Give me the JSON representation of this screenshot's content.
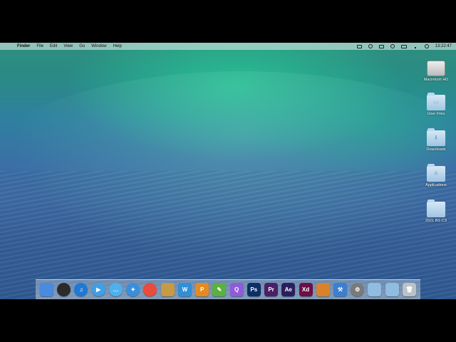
{
  "menubar": {
    "app": "Finder",
    "items": [
      "File",
      "Edit",
      "View",
      "Go",
      "Window",
      "Help"
    ],
    "time": "13:22:47"
  },
  "desktop": [
    {
      "label": "Macintosh HD",
      "kind": "drive"
    },
    {
      "label": "User Files",
      "kind": "folder"
    },
    {
      "label": "Downloads",
      "kind": "folder"
    },
    {
      "label": "Applications",
      "kind": "folder"
    },
    {
      "label": "2021 BS CS",
      "kind": "folder"
    }
  ],
  "dock": [
    {
      "name": "finder",
      "text": "",
      "bg": "#4a8be0"
    },
    {
      "name": "dashboard",
      "text": "",
      "bg": "#2b2b2b"
    },
    {
      "name": "itunes",
      "text": "♫",
      "bg": "#1e78d6"
    },
    {
      "name": "facetime",
      "text": "▶",
      "bg": "#3ea0e6"
    },
    {
      "name": "messages",
      "text": "…",
      "bg": "#4fb0ee"
    },
    {
      "name": "safari",
      "text": "✦",
      "bg": "#3a8fdc"
    },
    {
      "name": "chrome",
      "text": "",
      "bg": "#e94b3c"
    },
    {
      "name": "preview",
      "text": "",
      "bg": "#c79a45"
    },
    {
      "name": "wunderlist",
      "text": "W",
      "bg": "#2f8fd8"
    },
    {
      "name": "pencil",
      "text": "P",
      "bg": "#e48a23"
    },
    {
      "name": "evernote",
      "text": "✎",
      "bg": "#5bb040"
    },
    {
      "name": "purple-app",
      "text": "Q",
      "bg": "#8f5bd8"
    },
    {
      "name": "photoshop",
      "text": "Ps",
      "bg": "#0c2f66"
    },
    {
      "name": "premiere",
      "text": "Pr",
      "bg": "#4b1f66"
    },
    {
      "name": "after-effects",
      "text": "Ae",
      "bg": "#2a1f5e"
    },
    {
      "name": "adobe-xd",
      "text": "Xd",
      "bg": "#6a1046"
    },
    {
      "name": "image-capture",
      "text": "",
      "bg": "#d9822b"
    },
    {
      "name": "xcode",
      "text": "⚒",
      "bg": "#3c7fd1"
    },
    {
      "name": "system-preferences",
      "text": "⚙",
      "bg": "#7a7a7a"
    },
    {
      "name": "folder-a",
      "text": "",
      "bg": "#8fbce0"
    },
    {
      "name": "folder-b",
      "text": "",
      "bg": "#8fbce0"
    },
    {
      "name": "trash",
      "text": "🗑",
      "bg": "#b9c2c8"
    }
  ],
  "colors": {
    "menubar_text": "#111111",
    "label_text": "#ffffff"
  }
}
